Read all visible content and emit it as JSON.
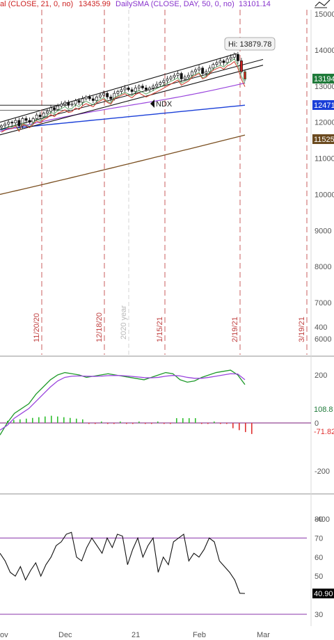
{
  "header": {
    "study1_text": "al (CLOSE, 21, 0, no)",
    "study1_value": "13435.99",
    "study2_text": "DailySMA (CLOSE, DAY, 50, 0, no)",
    "study2_value": "13101.14",
    "study1_color": "#cc2222",
    "study2_color": "#8833cc"
  },
  "tool_icon": "trendline-tool-icon",
  "price_panel": {
    "y_ticks": [
      "15000",
      "14000",
      "13000",
      "12000",
      "11000",
      "10000",
      "9000",
      "8000",
      "7000",
      "6000"
    ],
    "hi_label": "Hi: 13879.78",
    "symbol_label": "NDX",
    "badges": [
      {
        "text": "13194",
        "bg": "#1f7a3a",
        "fg": "#ffffff"
      },
      {
        "text": "12471",
        "bg": "#1a3fd8",
        "fg": "#ffffff"
      },
      {
        "text": "11525",
        "bg": "#6b4a1f",
        "fg": "#ffffff"
      }
    ],
    "date_labels": [
      {
        "text": "11/20/20",
        "color": "#c04040"
      },
      {
        "text": "12/18/20",
        "color": "#c04040"
      },
      {
        "text": "2020 year",
        "color": "#b8b8b8"
      },
      {
        "text": "1/15/21",
        "color": "#c04040"
      },
      {
        "text": "2/19/21",
        "color": "#c04040"
      },
      {
        "text": "3/19/21",
        "color": "#c04040"
      }
    ]
  },
  "macd_panel": {
    "y_ticks": [
      "400",
      "200",
      "0",
      "-200",
      "-400"
    ],
    "badges": [
      {
        "text": "108.8",
        "bg": "#ffffff",
        "fg": "#1f7a3a"
      },
      {
        "text": "-71.82",
        "bg": "#ffffff",
        "fg": "#e03030"
      }
    ]
  },
  "rsi_panel": {
    "y_ticks": [
      "80",
      "70",
      "60",
      "50",
      "40",
      "30"
    ],
    "badge": {
      "text": "40.90",
      "bg": "#000000",
      "fg": "#ffffff"
    }
  },
  "x_axis": {
    "labels": [
      "ov",
      "Dec",
      "21",
      "Feb",
      "Mar"
    ]
  },
  "chart_data": [
    {
      "type": "candlestick",
      "symbol": "NDX",
      "ylim": [
        5600,
        15300
      ],
      "x_range": [
        0,
        102
      ],
      "close_series": [
        11900,
        11950,
        12000,
        11980,
        12050,
        11900,
        12100,
        12050,
        12000,
        12100,
        12200,
        12150,
        12250,
        12300,
        12400,
        12350,
        12450,
        12500,
        12550,
        12480,
        12500,
        12600,
        12550,
        12650,
        12700,
        12650,
        12600,
        12700,
        12750,
        12800,
        12700,
        12650,
        12800,
        12850,
        12900,
        12950,
        12900,
        12850,
        12950,
        13000,
        12950,
        12900,
        12950,
        13000,
        13050,
        13100,
        13150,
        13200,
        13250,
        13300,
        13350,
        13200,
        13250,
        13300,
        13400,
        13450,
        13500,
        13350,
        13400,
        13500,
        13600,
        13650,
        13700,
        13650,
        13750,
        13800,
        13880,
        13700,
        13400,
        13194
      ],
      "sma21_end": 13435.99,
      "sma50_end": 13101.14,
      "levels": {
        "sma_blue": 12471,
        "sma_brown": 11525,
        "last": 13194,
        "high": 13879.78
      },
      "vertical_markers": [
        "11/20/20",
        "12/18/20",
        "2020 year",
        "1/15/21",
        "2/19/21",
        "3/19/21"
      ]
    },
    {
      "type": "line",
      "name": "MACD",
      "ylim": [
        -500,
        450
      ],
      "series": [
        {
          "name": "macd",
          "values": [
            -50,
            0,
            40,
            60,
            80,
            120,
            150,
            180,
            200,
            210,
            205,
            200,
            190,
            195,
            200,
            205,
            200,
            195,
            190,
            185,
            180,
            190,
            200,
            210,
            205,
            180,
            170,
            175,
            190,
            200,
            210,
            215,
            220,
            200,
            160
          ]
        },
        {
          "name": "signal",
          "values": [
            -30,
            -10,
            20,
            40,
            60,
            90,
            120,
            150,
            175,
            190,
            195,
            196,
            195,
            194,
            195,
            197,
            198,
            197,
            195,
            192,
            189,
            188,
            190,
            195,
            198,
            196,
            190,
            186,
            186,
            190,
            195,
            200,
            205,
            204,
            180
          ]
        }
      ],
      "last_values": [
        108.8,
        -71.82
      ]
    },
    {
      "type": "line",
      "name": "RSI",
      "ylim": [
        25,
        85
      ],
      "thresholds": [
        70,
        30
      ],
      "values": [
        62,
        58,
        52,
        50,
        55,
        48,
        53,
        57,
        50,
        56,
        60,
        66,
        68,
        72,
        73,
        60,
        58,
        65,
        70,
        66,
        62,
        70,
        65,
        72,
        71,
        56,
        64,
        70,
        60,
        66,
        70,
        52,
        60,
        56,
        68,
        70,
        72,
        58,
        62,
        60,
        64,
        70,
        68,
        58,
        55,
        52,
        48,
        41,
        40.9
      ],
      "last_value": 40.9
    }
  ]
}
